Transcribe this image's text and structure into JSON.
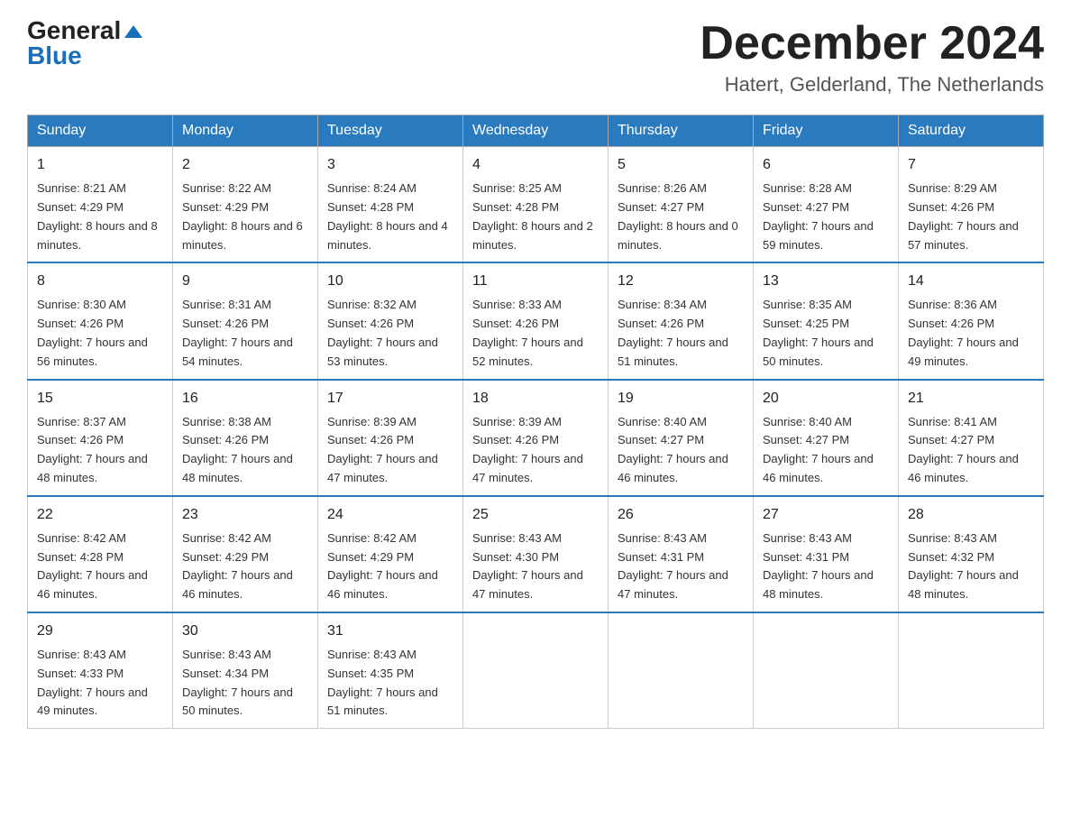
{
  "logo": {
    "general": "General",
    "blue": "Blue"
  },
  "title": "December 2024",
  "location": "Hatert, Gelderland, The Netherlands",
  "days_of_week": [
    "Sunday",
    "Monday",
    "Tuesday",
    "Wednesday",
    "Thursday",
    "Friday",
    "Saturday"
  ],
  "weeks": [
    [
      {
        "date": "1",
        "sunrise": "8:21 AM",
        "sunset": "4:29 PM",
        "daylight": "8 hours and 8 minutes."
      },
      {
        "date": "2",
        "sunrise": "8:22 AM",
        "sunset": "4:29 PM",
        "daylight": "8 hours and 6 minutes."
      },
      {
        "date": "3",
        "sunrise": "8:24 AM",
        "sunset": "4:28 PM",
        "daylight": "8 hours and 4 minutes."
      },
      {
        "date": "4",
        "sunrise": "8:25 AM",
        "sunset": "4:28 PM",
        "daylight": "8 hours and 2 minutes."
      },
      {
        "date": "5",
        "sunrise": "8:26 AM",
        "sunset": "4:27 PM",
        "daylight": "8 hours and 0 minutes."
      },
      {
        "date": "6",
        "sunrise": "8:28 AM",
        "sunset": "4:27 PM",
        "daylight": "7 hours and 59 minutes."
      },
      {
        "date": "7",
        "sunrise": "8:29 AM",
        "sunset": "4:26 PM",
        "daylight": "7 hours and 57 minutes."
      }
    ],
    [
      {
        "date": "8",
        "sunrise": "8:30 AM",
        "sunset": "4:26 PM",
        "daylight": "7 hours and 56 minutes."
      },
      {
        "date": "9",
        "sunrise": "8:31 AM",
        "sunset": "4:26 PM",
        "daylight": "7 hours and 54 minutes."
      },
      {
        "date": "10",
        "sunrise": "8:32 AM",
        "sunset": "4:26 PM",
        "daylight": "7 hours and 53 minutes."
      },
      {
        "date": "11",
        "sunrise": "8:33 AM",
        "sunset": "4:26 PM",
        "daylight": "7 hours and 52 minutes."
      },
      {
        "date": "12",
        "sunrise": "8:34 AM",
        "sunset": "4:26 PM",
        "daylight": "7 hours and 51 minutes."
      },
      {
        "date": "13",
        "sunrise": "8:35 AM",
        "sunset": "4:25 PM",
        "daylight": "7 hours and 50 minutes."
      },
      {
        "date": "14",
        "sunrise": "8:36 AM",
        "sunset": "4:26 PM",
        "daylight": "7 hours and 49 minutes."
      }
    ],
    [
      {
        "date": "15",
        "sunrise": "8:37 AM",
        "sunset": "4:26 PM",
        "daylight": "7 hours and 48 minutes."
      },
      {
        "date": "16",
        "sunrise": "8:38 AM",
        "sunset": "4:26 PM",
        "daylight": "7 hours and 48 minutes."
      },
      {
        "date": "17",
        "sunrise": "8:39 AM",
        "sunset": "4:26 PM",
        "daylight": "7 hours and 47 minutes."
      },
      {
        "date": "18",
        "sunrise": "8:39 AM",
        "sunset": "4:26 PM",
        "daylight": "7 hours and 47 minutes."
      },
      {
        "date": "19",
        "sunrise": "8:40 AM",
        "sunset": "4:27 PM",
        "daylight": "7 hours and 46 minutes."
      },
      {
        "date": "20",
        "sunrise": "8:40 AM",
        "sunset": "4:27 PM",
        "daylight": "7 hours and 46 minutes."
      },
      {
        "date": "21",
        "sunrise": "8:41 AM",
        "sunset": "4:27 PM",
        "daylight": "7 hours and 46 minutes."
      }
    ],
    [
      {
        "date": "22",
        "sunrise": "8:42 AM",
        "sunset": "4:28 PM",
        "daylight": "7 hours and 46 minutes."
      },
      {
        "date": "23",
        "sunrise": "8:42 AM",
        "sunset": "4:29 PM",
        "daylight": "7 hours and 46 minutes."
      },
      {
        "date": "24",
        "sunrise": "8:42 AM",
        "sunset": "4:29 PM",
        "daylight": "7 hours and 46 minutes."
      },
      {
        "date": "25",
        "sunrise": "8:43 AM",
        "sunset": "4:30 PM",
        "daylight": "7 hours and 47 minutes."
      },
      {
        "date": "26",
        "sunrise": "8:43 AM",
        "sunset": "4:31 PM",
        "daylight": "7 hours and 47 minutes."
      },
      {
        "date": "27",
        "sunrise": "8:43 AM",
        "sunset": "4:31 PM",
        "daylight": "7 hours and 48 minutes."
      },
      {
        "date": "28",
        "sunrise": "8:43 AM",
        "sunset": "4:32 PM",
        "daylight": "7 hours and 48 minutes."
      }
    ],
    [
      {
        "date": "29",
        "sunrise": "8:43 AM",
        "sunset": "4:33 PM",
        "daylight": "7 hours and 49 minutes."
      },
      {
        "date": "30",
        "sunrise": "8:43 AM",
        "sunset": "4:34 PM",
        "daylight": "7 hours and 50 minutes."
      },
      {
        "date": "31",
        "sunrise": "8:43 AM",
        "sunset": "4:35 PM",
        "daylight": "7 hours and 51 minutes."
      },
      null,
      null,
      null,
      null
    ]
  ]
}
